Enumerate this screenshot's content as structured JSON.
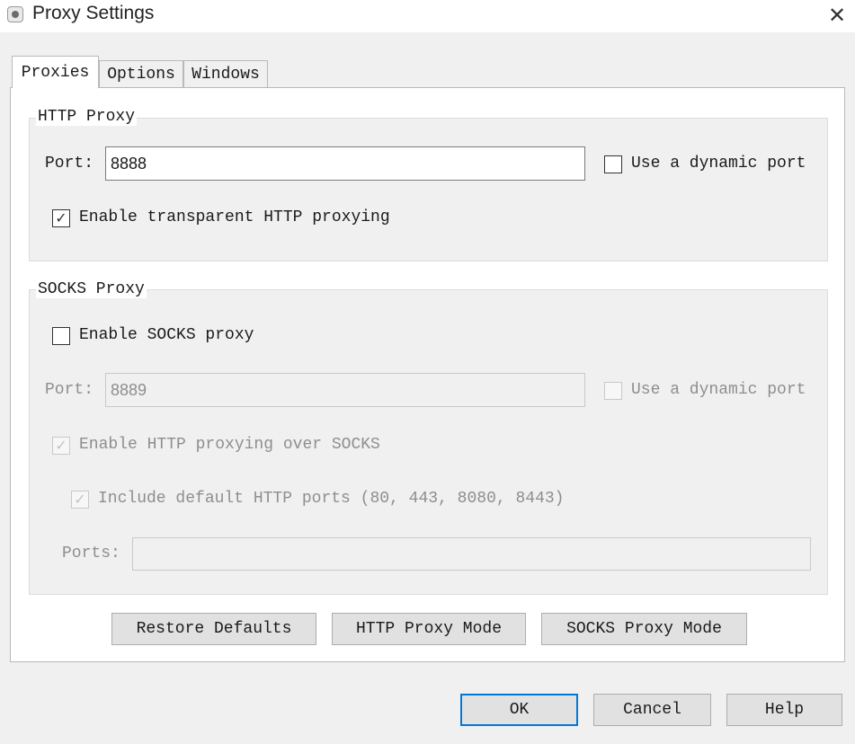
{
  "window": {
    "title": "Proxy Settings",
    "close_glyph": "✕"
  },
  "tabs": [
    {
      "label": "Proxies",
      "active": true
    },
    {
      "label": "Options",
      "active": false
    },
    {
      "label": "Windows",
      "active": false
    }
  ],
  "http_proxy": {
    "legend": "HTTP Proxy",
    "port_label": "Port:",
    "port_value": "8888",
    "dynamic_port_label": "Use a dynamic port",
    "dynamic_port_checked": false,
    "transparent_label": "Enable transparent HTTP proxying",
    "transparent_checked": true
  },
  "socks_proxy": {
    "legend": "SOCKS Proxy",
    "enable_label": "Enable SOCKS proxy",
    "enable_checked": false,
    "port_label": "Port:",
    "port_value": "8889",
    "dynamic_port_label": "Use a dynamic port",
    "http_over_socks_label": "Enable HTTP proxying over SOCKS",
    "http_over_socks_checked": true,
    "include_default_ports_label": "Include default HTTP ports (80, 443, 8080, 8443)",
    "include_default_ports_checked": true,
    "ports_label": "Ports:",
    "ports_value": ""
  },
  "action_buttons": {
    "restore_defaults": "Restore Defaults",
    "http_proxy_mode": "HTTP Proxy Mode",
    "socks_proxy_mode": "SOCKS Proxy Mode"
  },
  "dialog_buttons": {
    "ok": "OK",
    "cancel": "Cancel",
    "help": "Help"
  },
  "icons": {
    "check_glyph": "✓",
    "app_icon": "fiddler-app-icon"
  },
  "colors": {
    "accent": "#0078d7",
    "disabled_text": "#8e8e8e"
  }
}
